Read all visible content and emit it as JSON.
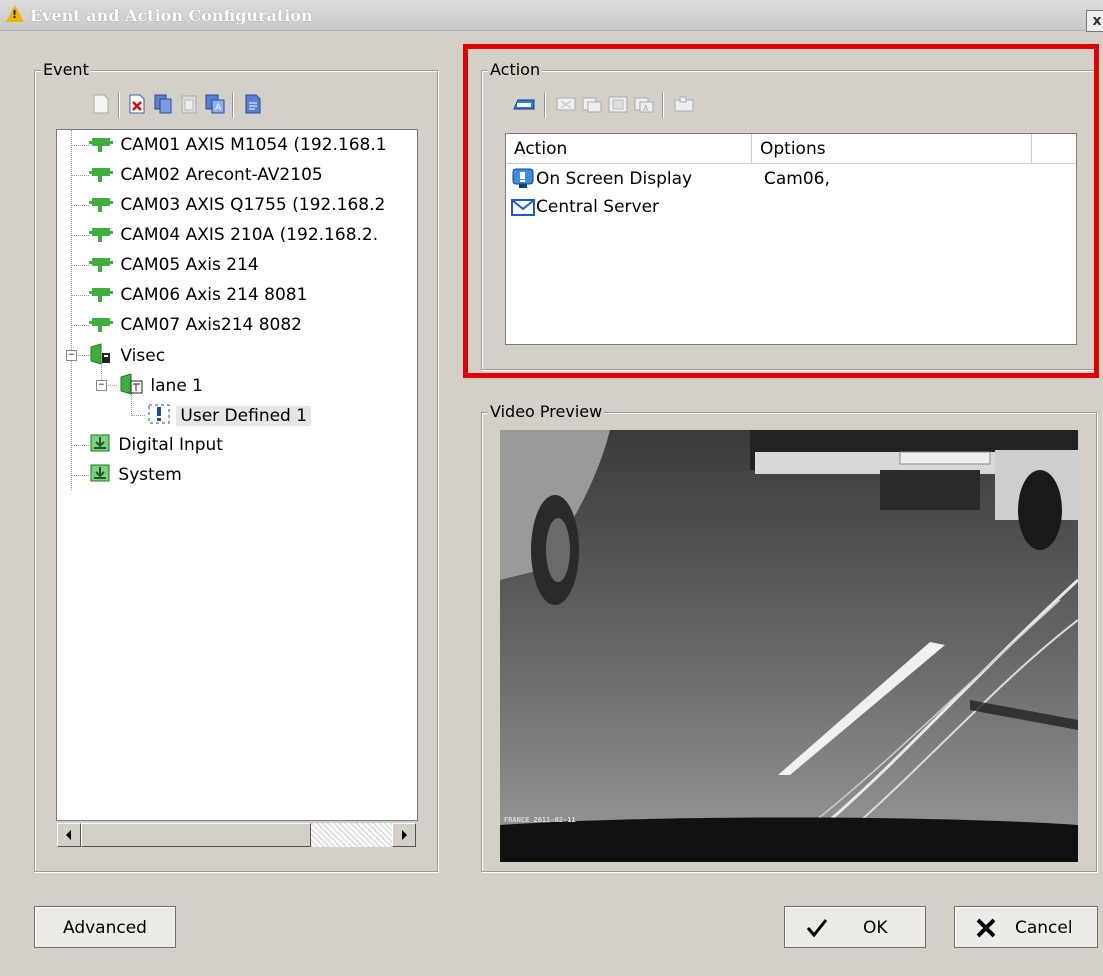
{
  "window": {
    "title": "Event and Action Configuration",
    "close_glyph": "x"
  },
  "event": {
    "legend": "Event",
    "toolbar": [
      "new-icon",
      "delete-icon",
      "copy-icon",
      "paste-icon",
      "duplicate-icon",
      "properties-icon"
    ],
    "tree": [
      {
        "label": "CAM01 AXIS M1054 (192.168.1",
        "icon": "camera-icon",
        "level": 1
      },
      {
        "label": "CAM02 Arecont-AV2105",
        "icon": "camera-icon",
        "level": 1
      },
      {
        "label": "CAM03 AXIS Q1755 (192.168.2",
        "icon": "camera-icon",
        "level": 1
      },
      {
        "label": "CAM04 AXIS 210A (192.168.2.",
        "icon": "camera-icon",
        "level": 1
      },
      {
        "label": "CAM05 Axis 214",
        "icon": "camera-icon",
        "level": 1
      },
      {
        "label": "CAM06 Axis 214 8081",
        "icon": "camera-icon",
        "level": 1
      },
      {
        "label": "CAM07 Axis214 8082",
        "icon": "camera-icon",
        "level": 1
      },
      {
        "label": "Visec",
        "icon": "visec-icon",
        "level": 1
      },
      {
        "label": "lane 1",
        "icon": "lane-icon",
        "level": 2
      },
      {
        "label": "User Defined 1",
        "icon": "user-event-icon",
        "level": 3
      },
      {
        "label": "Digital Input",
        "icon": "digital-input-icon",
        "level": 1
      },
      {
        "label": "System",
        "icon": "system-icon",
        "level": 1
      }
    ]
  },
  "action": {
    "legend": "Action",
    "toolbar": [
      "add-action-icon",
      "delete-action-icon",
      "copy-action-icon",
      "paste-action-icon",
      "edit-action-icon",
      "properties-action-icon"
    ],
    "columns": [
      "Action",
      "Options"
    ],
    "rows": [
      {
        "action": "On Screen Display",
        "options": "Cam06,",
        "icon": "monitor-icon"
      },
      {
        "action": "Central Server",
        "options": "",
        "icon": "mail-icon"
      }
    ]
  },
  "preview": {
    "legend": "Video Preview",
    "timestamp": "FRANCE 2011-02-11"
  },
  "buttons": {
    "advanced": "Advanced",
    "ok": "OK",
    "cancel": "Cancel"
  }
}
